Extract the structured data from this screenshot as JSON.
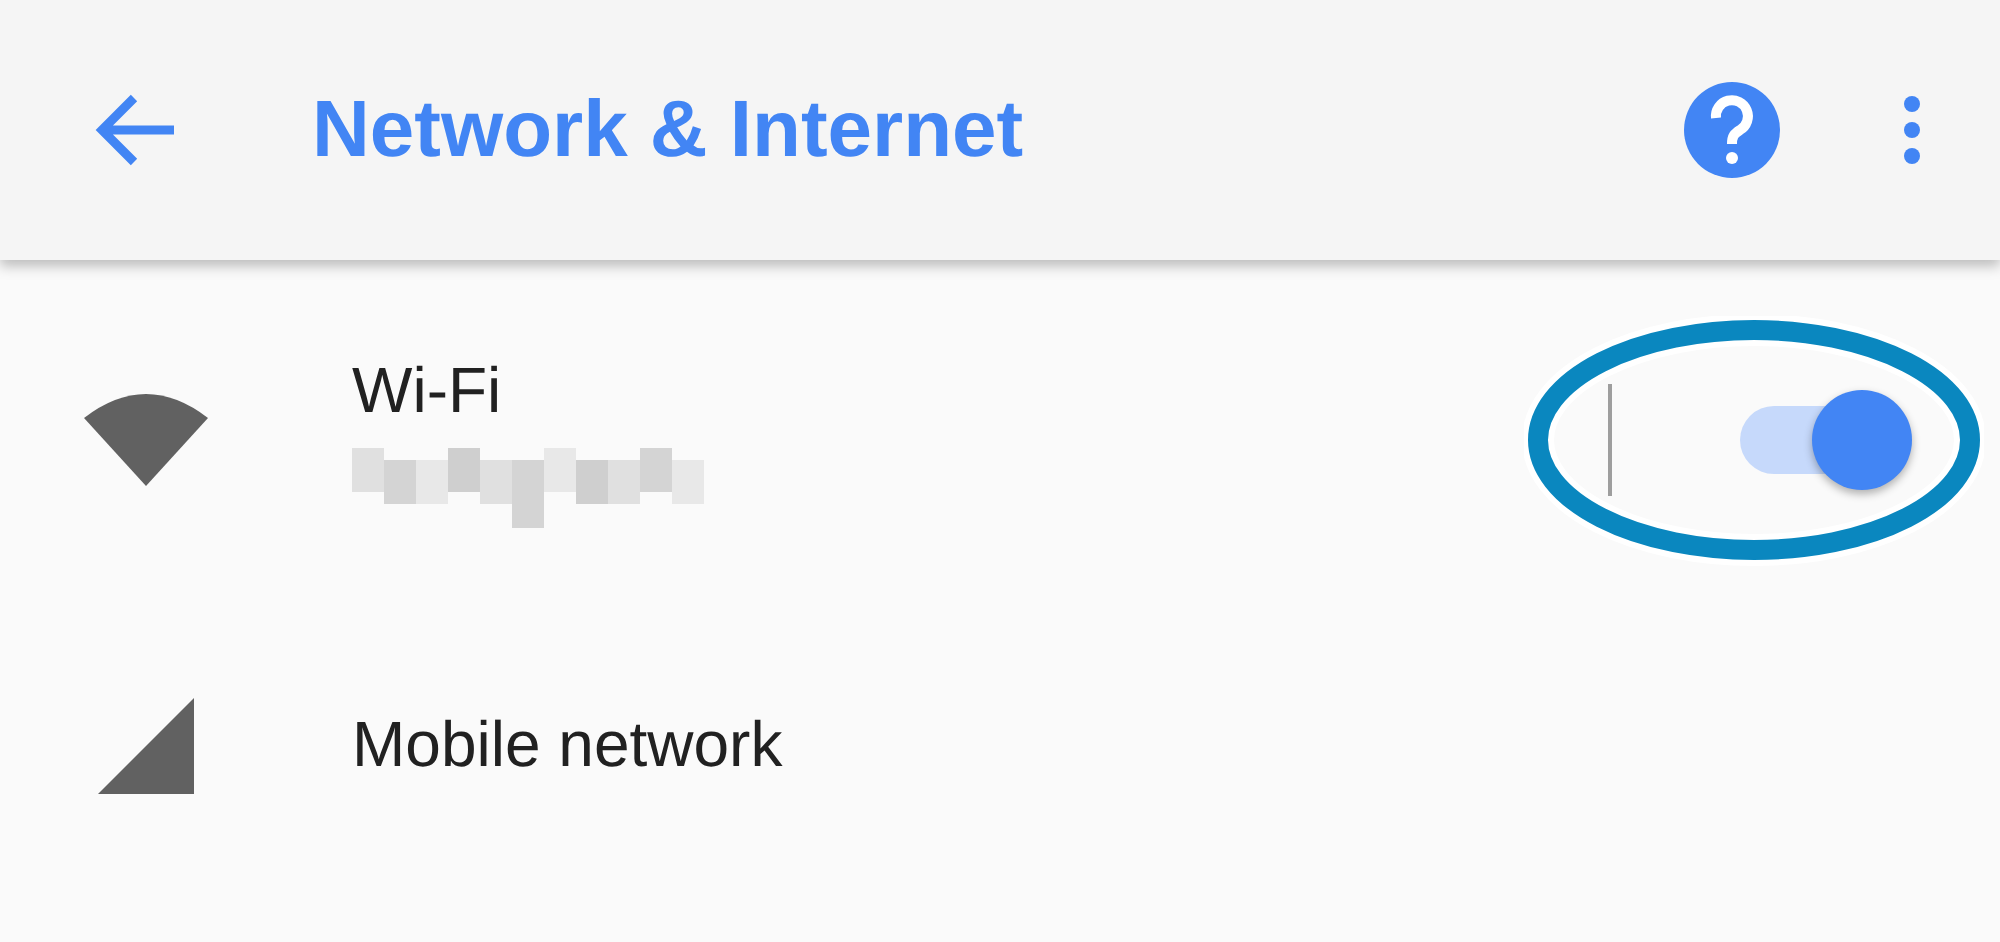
{
  "app_bar": {
    "title": "Network & Internet"
  },
  "settings": [
    {
      "kind": "toggle",
      "title": "Wi-Fi",
      "on": true,
      "highlighted": true
    },
    {
      "kind": "link",
      "title": "Mobile network"
    }
  ]
}
